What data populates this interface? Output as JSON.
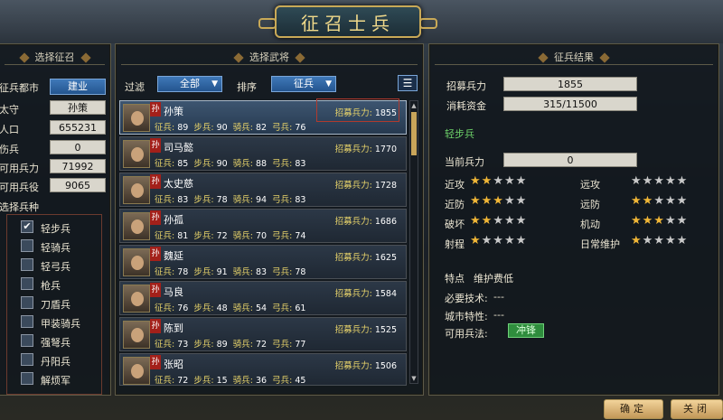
{
  "title": "征召士兵",
  "left": {
    "title": "选择征召",
    "city_label": "征兵都市",
    "city_value": "建业",
    "stats": [
      {
        "label": "太守",
        "value": "孙策"
      },
      {
        "label": "人口",
        "value": "655231"
      },
      {
        "label": "伤兵",
        "value": "0"
      },
      {
        "label": "可用兵力",
        "value": "71992"
      },
      {
        "label": "可用兵役",
        "value": "9065"
      }
    ],
    "unit_section": "选择兵种",
    "units": [
      {
        "label": "轻步兵",
        "checked": "✔"
      },
      {
        "label": "轻骑兵",
        "checked": ""
      },
      {
        "label": "轻弓兵",
        "checked": ""
      },
      {
        "label": "枪兵",
        "checked": ""
      },
      {
        "label": "刀盾兵",
        "checked": ""
      },
      {
        "label": "甲装骑兵",
        "checked": ""
      },
      {
        "label": "强弩兵",
        "checked": ""
      },
      {
        "label": "丹阳兵",
        "checked": ""
      },
      {
        "label": "解烦军",
        "checked": ""
      }
    ]
  },
  "middle": {
    "title": "选择武将",
    "filter_label": "过滤",
    "filter_value": "全部",
    "sort_label": "排序",
    "sort_value": "征兵",
    "generals": [
      {
        "faction": "孙",
        "name": "孙策",
        "recruit_label": "招募兵力:",
        "recruit": "1855",
        "s1": "征兵:",
        "v1": "89",
        "s2": "步兵:",
        "v2": "90",
        "s3": "骑兵:",
        "v3": "82",
        "s4": "弓兵:",
        "v4": "76"
      },
      {
        "faction": "孙",
        "name": "司马懿",
        "recruit_label": "招募兵力:",
        "recruit": "1770",
        "s1": "征兵:",
        "v1": "85",
        "s2": "步兵:",
        "v2": "90",
        "s3": "骑兵:",
        "v3": "88",
        "s4": "弓兵:",
        "v4": "83"
      },
      {
        "faction": "孙",
        "name": "太史慈",
        "recruit_label": "招募兵力:",
        "recruit": "1728",
        "s1": "征兵:",
        "v1": "83",
        "s2": "步兵:",
        "v2": "78",
        "s3": "骑兵:",
        "v3": "94",
        "s4": "弓兵:",
        "v4": "83"
      },
      {
        "faction": "孙",
        "name": "孙孤",
        "recruit_label": "招募兵力:",
        "recruit": "1686",
        "s1": "征兵:",
        "v1": "81",
        "s2": "步兵:",
        "v2": "72",
        "s3": "骑兵:",
        "v3": "70",
        "s4": "弓兵:",
        "v4": "74"
      },
      {
        "faction": "孙",
        "name": "魏延",
        "recruit_label": "招募兵力:",
        "recruit": "1625",
        "s1": "征兵:",
        "v1": "78",
        "s2": "步兵:",
        "v2": "91",
        "s3": "骑兵:",
        "v3": "83",
        "s4": "弓兵:",
        "v4": "78"
      },
      {
        "faction": "孙",
        "name": "马良",
        "recruit_label": "招募兵力:",
        "recruit": "1584",
        "s1": "征兵:",
        "v1": "76",
        "s2": "步兵:",
        "v2": "48",
        "s3": "骑兵:",
        "v3": "54",
        "s4": "弓兵:",
        "v4": "61"
      },
      {
        "faction": "孙",
        "name": "陈到",
        "recruit_label": "招募兵力:",
        "recruit": "1525",
        "s1": "征兵:",
        "v1": "73",
        "s2": "步兵:",
        "v2": "89",
        "s3": "骑兵:",
        "v3": "72",
        "s4": "弓兵:",
        "v4": "77"
      },
      {
        "faction": "孙",
        "name": "张昭",
        "recruit_label": "招募兵力:",
        "recruit": "1506",
        "s1": "征兵:",
        "v1": "72",
        "s2": "步兵:",
        "v2": "15",
        "s3": "骑兵:",
        "v3": "36",
        "s4": "弓兵:",
        "v4": "45"
      }
    ]
  },
  "right": {
    "title": "征兵结果",
    "recruit_label": "招募兵力",
    "recruit_value": "1855",
    "cost_label": "消耗资金",
    "cost_value": "315/11500",
    "unit_name": "轻步兵",
    "current_label": "当前兵力",
    "current_value": "0",
    "ratings": [
      {
        "label": "近攻",
        "stars": 2
      },
      {
        "label": "远攻",
        "stars": 0
      },
      {
        "label": "近防",
        "stars": 3
      },
      {
        "label": "远防",
        "stars": 2
      },
      {
        "label": "破坏",
        "stars": 2
      },
      {
        "label": "机动",
        "stars": 3
      },
      {
        "label": "射程",
        "stars": 1
      },
      {
        "label": "日常维护",
        "stars": 1
      }
    ],
    "trait_label": "特点",
    "trait_value": "维护费低",
    "tech_label": "必要技术:",
    "tech_value": "---",
    "city_label": "城市特性:",
    "city_value": "---",
    "tactic_label": "可用兵法:",
    "tactic_value": "冲锋"
  },
  "buttons": {
    "confirm": "确定",
    "close": "关闭"
  }
}
